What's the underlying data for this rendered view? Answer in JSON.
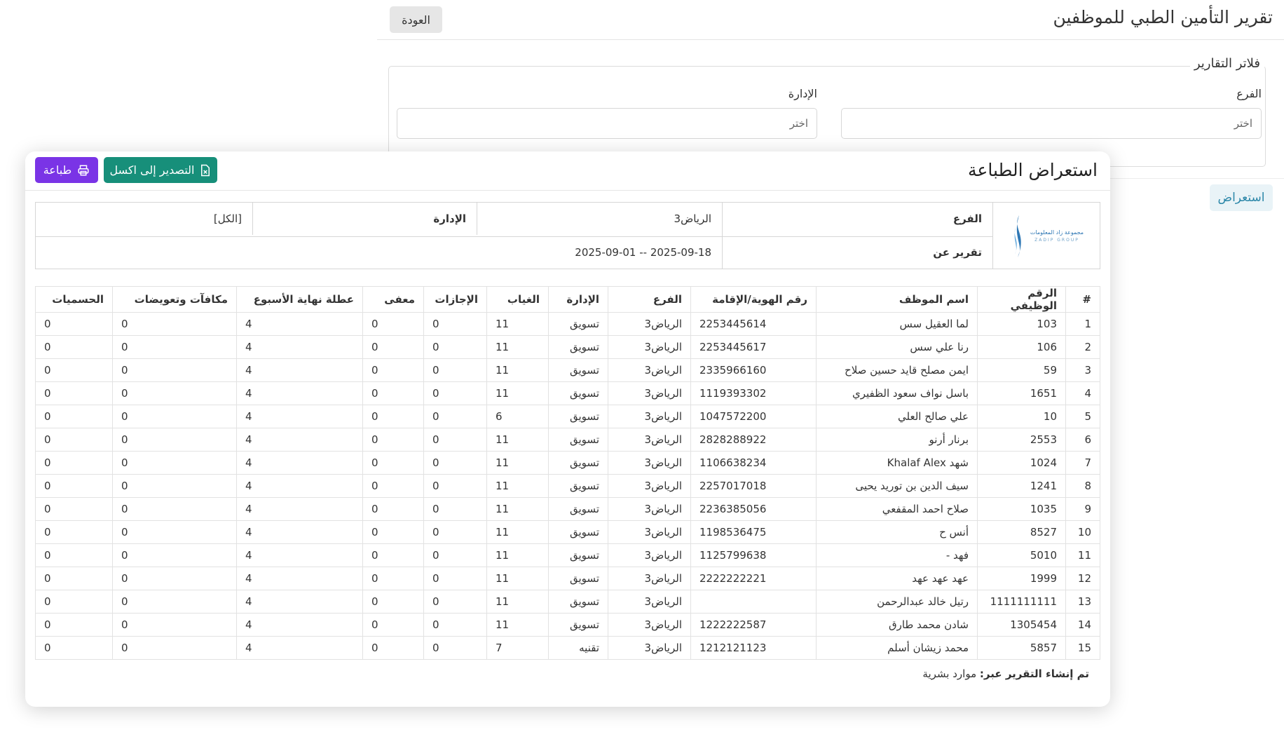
{
  "page": {
    "title": "تقرير التأمين الطبي للموظفين",
    "back_label": "العودة",
    "filters_legend": "فلاتر التقارير",
    "branch_label": "الفرع",
    "branch_placeholder": "اختر",
    "dept_label": "الإدارة",
    "dept_placeholder": "اختر",
    "view_label": "استعراض"
  },
  "modal": {
    "title": "استعراض الطباعة",
    "print_label": "طباعة",
    "excel_label": "التصدير إلى اكسل",
    "logo_text": "مجموعة زاد المعلومات",
    "logo_sub": "ZADIP GROUP",
    "info": {
      "branch_key": "الفرع",
      "branch_val": "الرياض3",
      "dept_key": "الإدارة",
      "dept_val": "[الكل]",
      "report_key": "تقرير عن",
      "report_val": "2025-09-01 -- 2025-09-18"
    },
    "columns": [
      "#",
      "الرقم الوظيفي",
      "اسم الموظف",
      "رقم الهوية/الإقامة",
      "الفرع",
      "الإدارة",
      "الغياب",
      "الإجازات",
      "معفى",
      "عطلة نهاية الأسبوع",
      "مكافآت وتعويضات",
      "الحسميات"
    ],
    "rows": [
      [
        "1",
        "103",
        "لما العقيل سس",
        "2253445614",
        "الرياض3",
        "تسويق",
        "11",
        "0",
        "0",
        "4",
        "0",
        "0"
      ],
      [
        "2",
        "106",
        "رنا علي سس",
        "2253445617",
        "الرياض3",
        "تسويق",
        "11",
        "0",
        "0",
        "4",
        "0",
        "0"
      ],
      [
        "3",
        "59",
        "ايمن مصلح قايد حسين صلاح",
        "2335966160",
        "الرياض3",
        "تسويق",
        "11",
        "0",
        "0",
        "4",
        "0",
        "0"
      ],
      [
        "4",
        "1651",
        "باسل نواف سعود الظفيري",
        "1119393302",
        "الرياض3",
        "تسويق",
        "11",
        "0",
        "0",
        "4",
        "0",
        "0"
      ],
      [
        "5",
        "10",
        "علي صالح العلي",
        "1047572200",
        "الرياض3",
        "تسويق",
        "6",
        "0",
        "0",
        "4",
        "0",
        "0"
      ],
      [
        "6",
        "2553",
        "برنار أرنو",
        "2828288922",
        "الرياض3",
        "تسويق",
        "11",
        "0",
        "0",
        "4",
        "0",
        "0"
      ],
      [
        "7",
        "1024",
        "شهد Khalaf Alex",
        "1106638234",
        "الرياض3",
        "تسويق",
        "11",
        "0",
        "0",
        "4",
        "0",
        "0"
      ],
      [
        "8",
        "1241",
        "سيف الدين بن توريد يحيى",
        "2257017018",
        "الرياض3",
        "تسويق",
        "11",
        "0",
        "0",
        "4",
        "0",
        "0"
      ],
      [
        "9",
        "1035",
        "صلاح احمد المقفعي",
        "2236385056",
        "الرياض3",
        "تسويق",
        "11",
        "0",
        "0",
        "4",
        "0",
        "0"
      ],
      [
        "10",
        "8527",
        "أنس ح",
        "1198536475",
        "الرياض3",
        "تسويق",
        "11",
        "0",
        "0",
        "4",
        "0",
        "0"
      ],
      [
        "11",
        "5010",
        "فهد -",
        "1125799638",
        "الرياض3",
        "تسويق",
        "11",
        "0",
        "0",
        "4",
        "0",
        "0"
      ],
      [
        "12",
        "1999",
        "عهد عهد عهد",
        "2222222221",
        "الرياض3",
        "تسويق",
        "11",
        "0",
        "0",
        "4",
        "0",
        "0"
      ],
      [
        "13",
        "1111111111",
        "رتيل خالد عبدالرحمن",
        "",
        "الرياض3",
        "تسويق",
        "11",
        "0",
        "0",
        "4",
        "0",
        "0"
      ],
      [
        "14",
        "1305454",
        "شادن محمد طارق",
        "1222222587",
        "الرياض3",
        "تسويق",
        "11",
        "0",
        "0",
        "4",
        "0",
        "0"
      ],
      [
        "15",
        "5857",
        "محمد زيشان أسلم",
        "1212121123",
        "الرياض3",
        "تقنيه",
        "7",
        "0",
        "0",
        "4",
        "0",
        "0"
      ]
    ],
    "footer_key": "تم إنشاء التقرير عبر:",
    "footer_val": "موارد بشرية"
  }
}
